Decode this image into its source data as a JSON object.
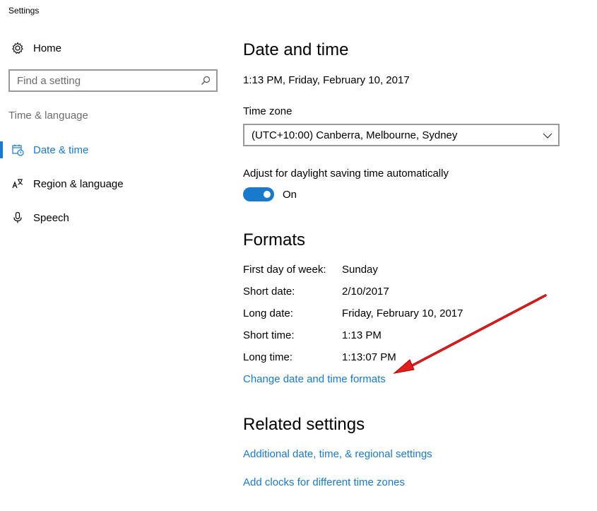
{
  "window": {
    "title": "Settings"
  },
  "sidebar": {
    "home_label": "Home",
    "search_placeholder": "Find a setting",
    "section_title": "Time & language",
    "items": [
      {
        "label": "Date & time",
        "icon": "calendar-clock-icon",
        "active": true
      },
      {
        "label": "Region & language",
        "icon": "language-icon",
        "active": false
      },
      {
        "label": "Speech",
        "icon": "microphone-icon",
        "active": false
      }
    ]
  },
  "main": {
    "title": "Date and time",
    "current_datetime": "1:13 PM, Friday, February 10, 2017",
    "timezone": {
      "label": "Time zone",
      "value": "(UTC+10:00) Canberra, Melbourne, Sydney"
    },
    "dst": {
      "label": "Adjust for daylight saving time automatically",
      "state_label": "On",
      "on": true
    },
    "formats": {
      "title": "Formats",
      "rows": [
        {
          "label": "First day of week:",
          "value": "Sunday"
        },
        {
          "label": "Short date:",
          "value": "2/10/2017"
        },
        {
          "label": "Long date:",
          "value": "Friday, February 10, 2017"
        },
        {
          "label": "Short time:",
          "value": "1:13 PM"
        },
        {
          "label": "Long time:",
          "value": "1:13:07 PM"
        }
      ],
      "change_link": "Change date and time formats"
    },
    "related": {
      "title": "Related settings",
      "links": [
        "Additional date, time, & regional settings",
        "Add clocks for different time zones"
      ]
    }
  },
  "colors": {
    "accent": "#1979ca",
    "annotation_arrow": "#e02020"
  }
}
